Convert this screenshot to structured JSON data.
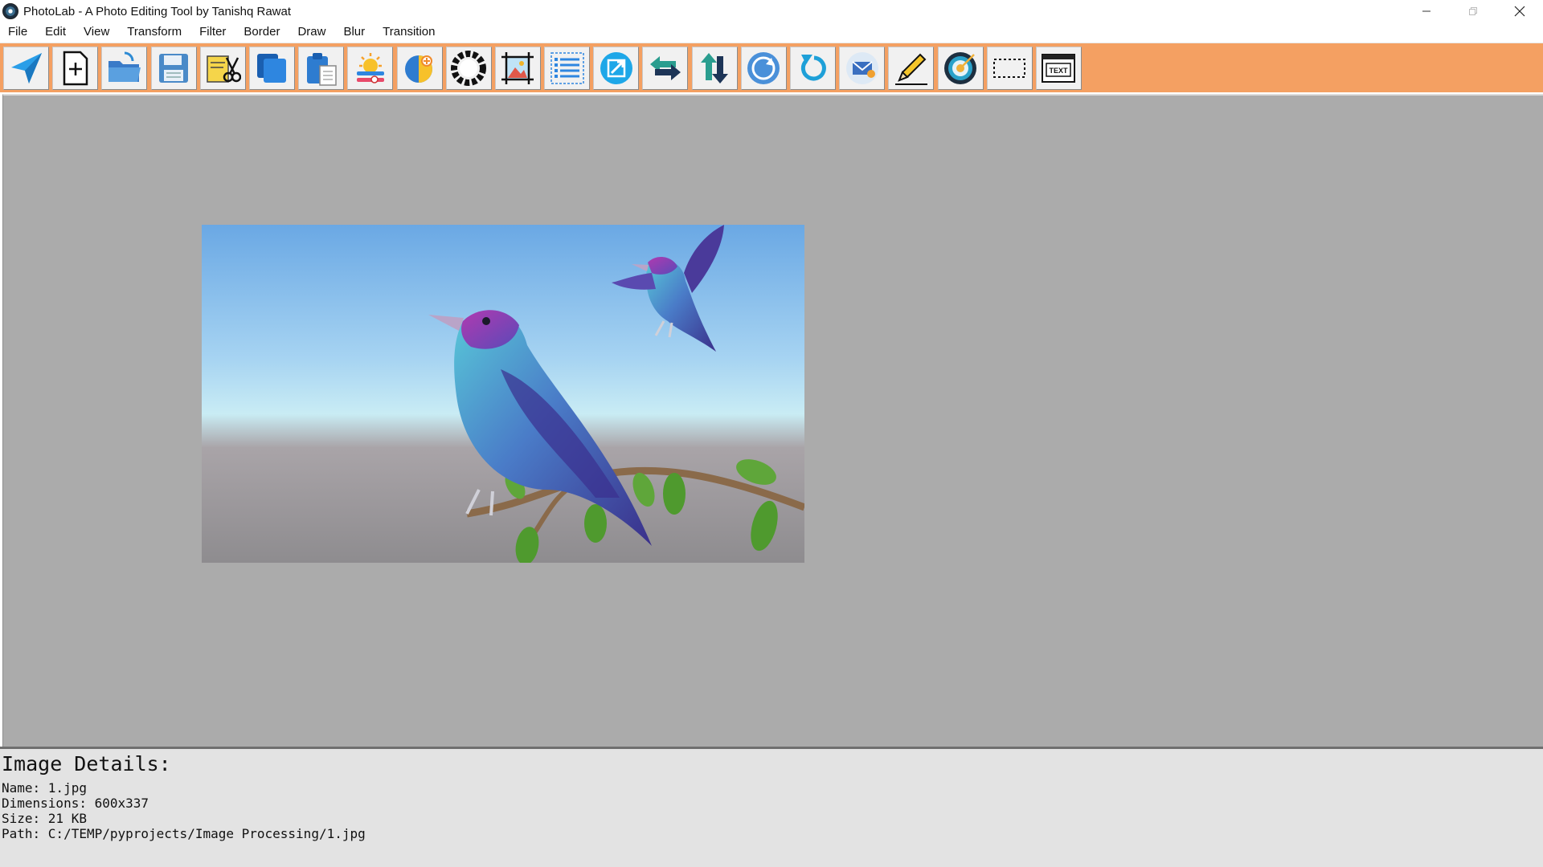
{
  "window": {
    "title": "PhotoLab - A Photo Editing Tool by Tanishq Rawat",
    "controls": [
      "minimize",
      "maximize",
      "close"
    ]
  },
  "menu": {
    "items": [
      {
        "label": "File"
      },
      {
        "label": "Edit"
      },
      {
        "label": "View"
      },
      {
        "label": "Transform"
      },
      {
        "label": "Filter"
      },
      {
        "label": "Border"
      },
      {
        "label": "Draw"
      },
      {
        "label": "Blur"
      },
      {
        "label": "Transition"
      }
    ]
  },
  "toolbar": {
    "background": "#f4a062",
    "tools": [
      {
        "icon": "send-icon"
      },
      {
        "icon": "new-file-icon"
      },
      {
        "icon": "open-folder-icon"
      },
      {
        "icon": "save-icon"
      },
      {
        "icon": "cut-icon"
      },
      {
        "icon": "copy-icon"
      },
      {
        "icon": "paste-icon"
      },
      {
        "icon": "brightness-icon"
      },
      {
        "icon": "contrast-icon"
      },
      {
        "icon": "color-wheel-icon"
      },
      {
        "icon": "crop-image-icon"
      },
      {
        "icon": "list-icon"
      },
      {
        "icon": "resize-icon"
      },
      {
        "icon": "flip-horizontal-icon"
      },
      {
        "icon": "flip-vertical-icon"
      },
      {
        "icon": "rotate-icon"
      },
      {
        "icon": "undo-icon"
      },
      {
        "icon": "mail-icon"
      },
      {
        "icon": "pencil-icon"
      },
      {
        "icon": "target-icon"
      },
      {
        "icon": "selection-icon"
      },
      {
        "icon": "text-icon"
      }
    ],
    "text_tool_label": "TEXT"
  },
  "canvas": {
    "background": "#ababab"
  },
  "details": {
    "title": "Image Details:",
    "name_label": "Name: ",
    "name": "1.jpg",
    "dimensions_label": "Dimensions: ",
    "dimensions": "600x337",
    "size_label": "Size: ",
    "size": "21 KB",
    "path_label": "Path: ",
    "path": "C:/TEMP/pyprojects/Image Processing/1.jpg"
  }
}
